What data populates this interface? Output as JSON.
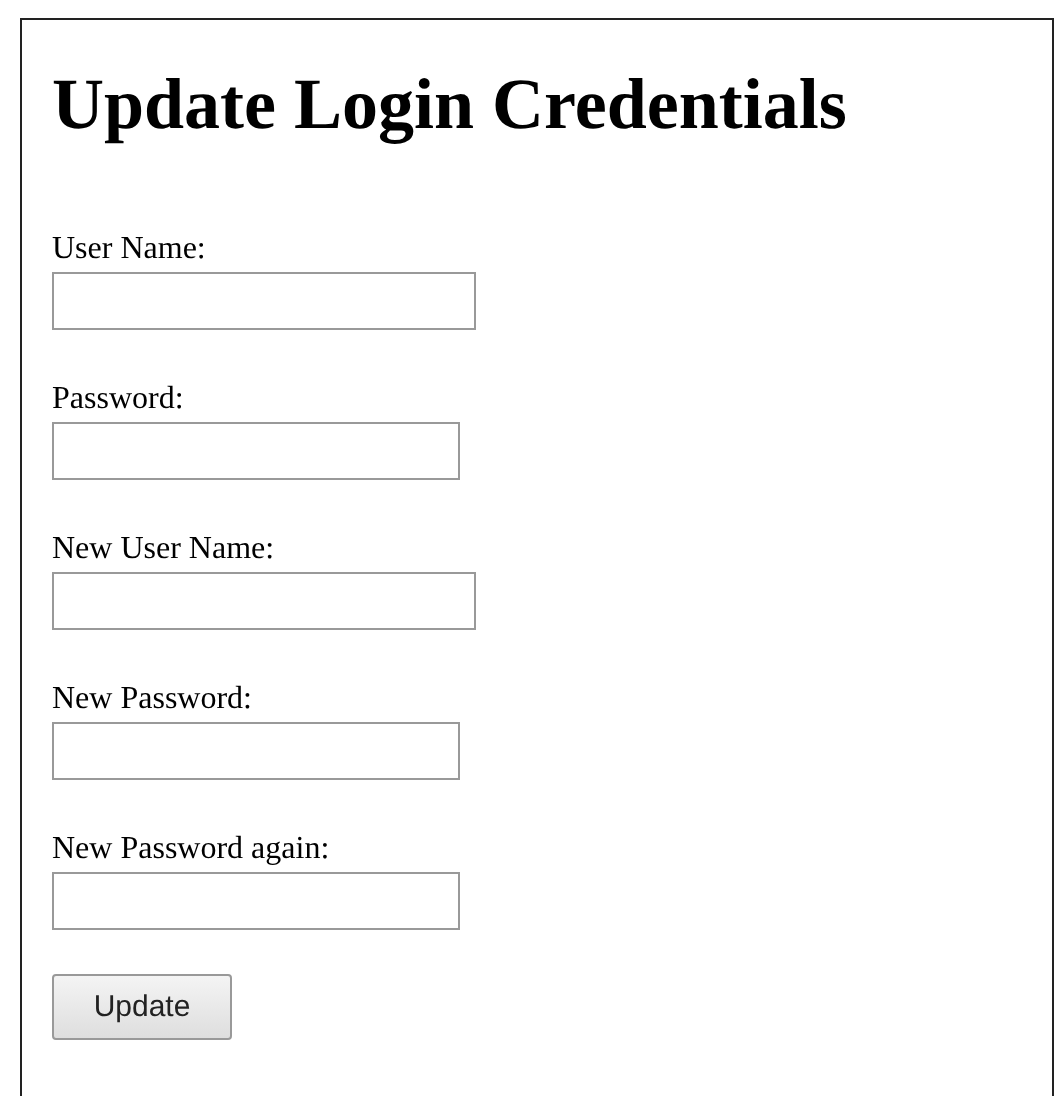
{
  "title": "Update Login Credentials",
  "fields": [
    {
      "label": "User Name:",
      "kind": "text"
    },
    {
      "label": "Password:",
      "kind": "password"
    },
    {
      "label": "New User Name:",
      "kind": "text"
    },
    {
      "label": "New Password:",
      "kind": "password"
    },
    {
      "label": "New Password again:",
      "kind": "password"
    }
  ],
  "button": "Update"
}
